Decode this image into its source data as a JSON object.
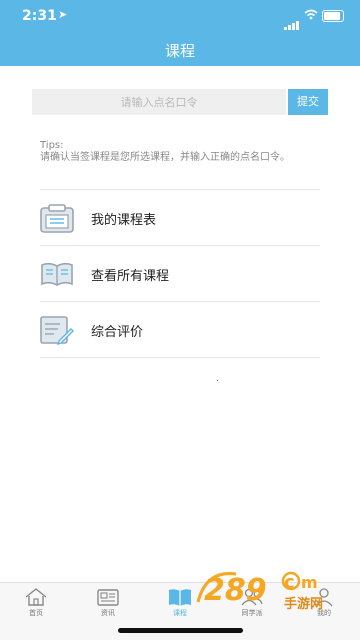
{
  "status": {
    "time": "2:31"
  },
  "header": {
    "title": "课程"
  },
  "code_form": {
    "placeholder": "请输入点名口令",
    "value": "",
    "submit_label": "提交"
  },
  "tips": {
    "heading": "Tips:",
    "text": "请确认当签课程是您所选课程，并输入正确的点名口令。"
  },
  "menu": [
    {
      "label": "我的课程表",
      "icon": "schedule-icon"
    },
    {
      "label": "查看所有课程",
      "icon": "book-icon"
    },
    {
      "label": "综合评价",
      "icon": "edit-icon"
    }
  ],
  "tabs": [
    {
      "label": "首页",
      "icon": "home-icon"
    },
    {
      "label": "资讯",
      "icon": "news-icon"
    },
    {
      "label": "课程",
      "icon": "book-icon",
      "active": true
    },
    {
      "label": "同学派",
      "icon": "people-icon"
    },
    {
      "label": "我的",
      "icon": "user-icon"
    }
  ],
  "colors": {
    "accent": "#5bb8e6",
    "icon_gray": "#9aa4ae"
  },
  "watermark": {
    "text": "289com",
    "sub": "手游网"
  }
}
